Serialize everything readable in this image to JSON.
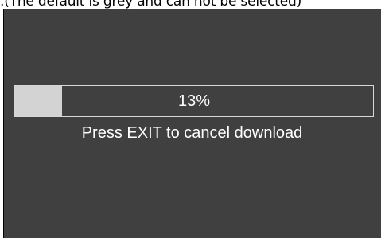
{
  "caption": ".(The default is grey and can not be selected)",
  "download": {
    "progress_fraction": 0.13,
    "progress_text": "13%",
    "hint": "Press EXIT to cancel download"
  },
  "colors": {
    "screen_background": "#404040",
    "progress_fill": "#d3d3d3",
    "progress_border": "#d6d6d6",
    "text": "#ffffff"
  }
}
